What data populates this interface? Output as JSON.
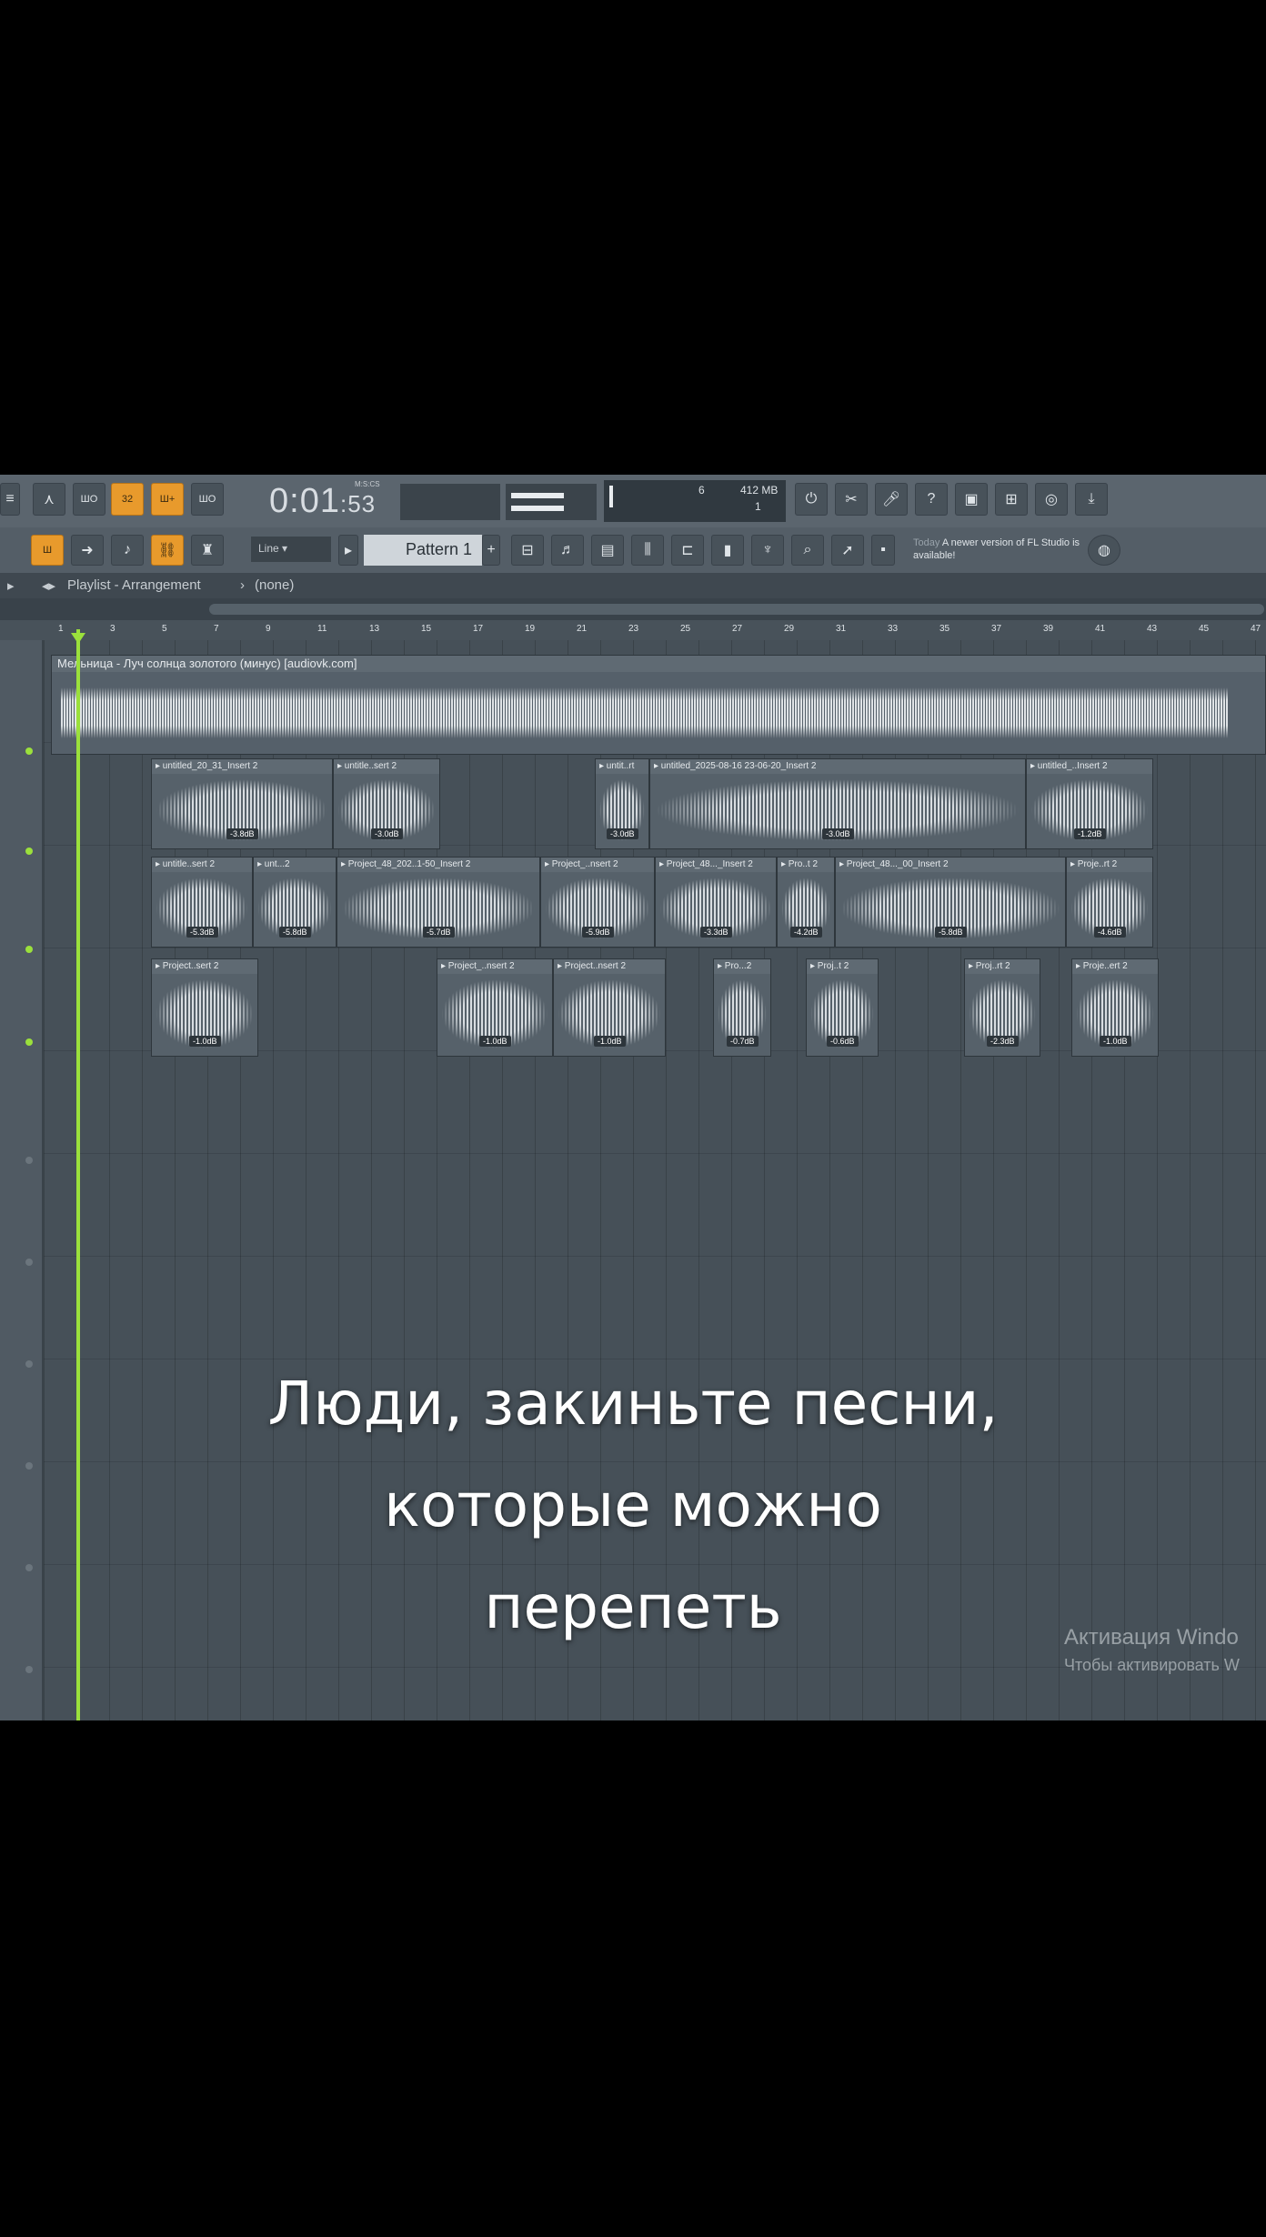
{
  "toolbar": {
    "time": "0:01",
    "time_fraction": "53",
    "time_unit": "M:S:CS",
    "cpu_value": "6",
    "memory": "412 MB",
    "polyphony": "1",
    "line_mode": "Line",
    "pattern": "Pattern 1",
    "news_date": "Today",
    "news_text": "A newer version of FL Studio is available!"
  },
  "playlist": {
    "title": "Playlist - Arrangement",
    "arrangement": "(none)",
    "ruler_marks": [
      "1",
      "3",
      "5",
      "7",
      "9",
      "11",
      "13",
      "15",
      "17",
      "19",
      "21",
      "23",
      "25",
      "27",
      "29",
      "31",
      "33",
      "35",
      "37",
      "39",
      "41",
      "43",
      "45",
      "47"
    ],
    "main_clip_title": "Мельница - Луч солнца золотого (минус) [audiovk.com]",
    "clips": [
      {
        "title": "untitled_20_31_Insert 2",
        "db": "-3.8dB"
      },
      {
        "title": "untitle..sert 2",
        "db": "-3.0dB"
      },
      {
        "title": "untit..rt",
        "db": "-3.0dB"
      },
      {
        "title": "untitled_2025-08-16 23-06-20_Insert 2",
        "db": "-3.0dB"
      },
      {
        "title": "untitled_..Insert 2",
        "db": "-1.2dB"
      },
      {
        "title": "untitle..sert 2",
        "db": "-5.3dB"
      },
      {
        "title": "unt...2",
        "db": "-5.8dB"
      },
      {
        "title": "Project_48_202..1-50_Insert 2",
        "db": "-5.7dB"
      },
      {
        "title": "Project_..nsert 2",
        "db": "-5.9dB"
      },
      {
        "title": "Project_48..._Insert 2",
        "db": "-3.3dB"
      },
      {
        "title": "Pro..t 2",
        "db": "-4.2dB"
      },
      {
        "title": "Project_48..._00_Insert 2",
        "db": "-5.8dB"
      },
      {
        "title": "Proje..rt 2",
        "db": "-4.6dB"
      },
      {
        "title": "Project..sert 2",
        "db": "-1.0dB"
      },
      {
        "title": "Project_..nsert 2",
        "db": "-1.0dB"
      },
      {
        "title": "Project..nsert 2",
        "db": "-1.0dB"
      },
      {
        "title": "Pro...2",
        "db": "-0.7dB"
      },
      {
        "title": "Proj..t 2",
        "db": "-0.6dB"
      },
      {
        "title": "Proj..rt 2",
        "db": "-2.3dB"
      },
      {
        "title": "Proje..ert 2",
        "db": "-1.0dB"
      }
    ]
  },
  "caption": {
    "line1": "Люди, закиньте песни,",
    "line2": "которые можно",
    "line3": "перепеть"
  },
  "watermark": {
    "line1": "Активация Windo",
    "line2": "Чтобы активировать W"
  }
}
